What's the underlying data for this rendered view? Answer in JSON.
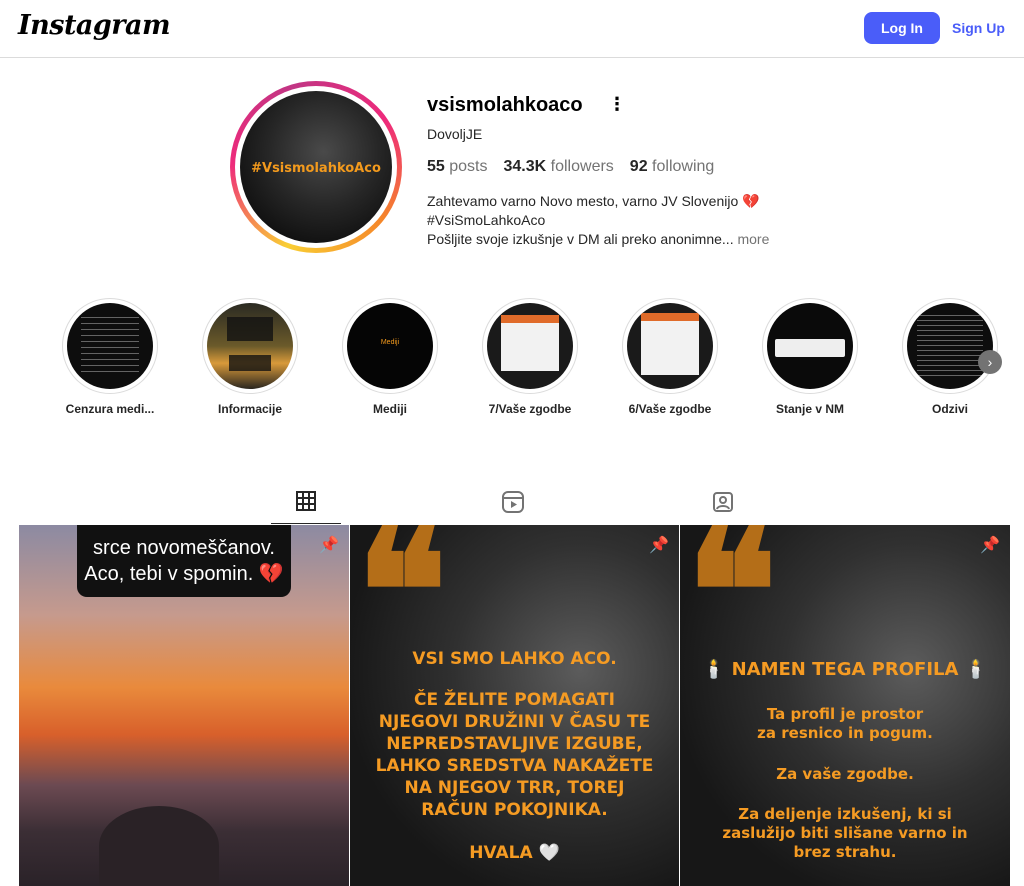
{
  "header": {
    "logo": "Instagram",
    "login_label": "Log In",
    "signup_label": "Sign Up"
  },
  "profile": {
    "avatar_text": "#VsismolahkoAco",
    "username": "vsismolahkoaco",
    "more_icon": "more-dots-icon",
    "full_name": "DovoljJE",
    "stats": {
      "posts_count": "55",
      "posts_label": "posts",
      "followers_count": "34.3K",
      "followers_label": "followers",
      "following_count": "92",
      "following_label": "following"
    },
    "bio": {
      "line1": "Zahtevamo varno Novo mesto, varno JV Slovenijo 💔",
      "line2": "#VsiSmoLahkoAco",
      "line3": "Pošljite svoje izkušnje v DM ali preko anonimne...",
      "more": "more"
    }
  },
  "highlights": [
    {
      "label": "Cenzura medi..."
    },
    {
      "label": "Informacije"
    },
    {
      "label": "Mediji",
      "inner_text": "Mediji"
    },
    {
      "label": "7/Vaše zgodbe"
    },
    {
      "label": "6/Vaše zgodbe"
    },
    {
      "label": "Stanje v NM"
    },
    {
      "label": "Odzivi"
    }
  ],
  "tabs": [
    {
      "icon": "grid-icon",
      "active": true
    },
    {
      "icon": "reels-icon",
      "active": false
    },
    {
      "icon": "tagged-icon",
      "active": false
    }
  ],
  "posts": [
    {
      "caption_line1": "srce novomeščanov.",
      "caption_line2": "Aco, tebi v spomin. 💔"
    },
    {
      "quote": "❝",
      "line1": "VSI SMO LAHKO ACO.",
      "line2": "ČE ŽELITE POMAGATI NJEGOVI DRUŽINI V ČASU TE NEPREDSTAVLJIVE IZGUBE, LAHKO SREDSTVA NAKAŽETE NA NJEGOV TRR, TOREJ RAČUN POKOJNIKA.",
      "line3": "HVALA 🤍"
    },
    {
      "quote": "❝",
      "line1": "🕯️ NAMEN TEGA PROFILA 🕯️",
      "line2": "Ta profil je prostor za resnico in pogum.",
      "line3": "Za vaše zgodbe.",
      "line4": "Za deljenje izkušenj, ki si zaslužijo biti slišane varno in brez strahu."
    }
  ],
  "colors": {
    "accent": "#4a5df9",
    "post_text": "#f59b23"
  }
}
